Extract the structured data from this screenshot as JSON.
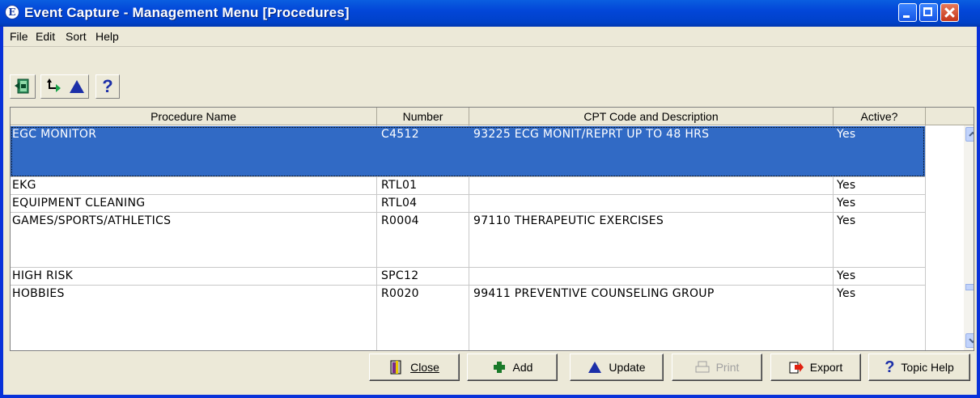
{
  "window": {
    "title": "Event Capture - Management Menu [Procedures]",
    "app_icon_glyph": "E"
  },
  "menu": [
    "File",
    "Edit",
    "Sort",
    "Help"
  ],
  "toolbar": {
    "icons": [
      "exit-icon",
      "move-to-icon",
      "up-arrow-icon",
      "help-icon"
    ],
    "help_glyph": "?"
  },
  "grid": {
    "columns": [
      "Procedure Name",
      "Number",
      "CPT Code and Description",
      "Active?"
    ],
    "rows": [
      {
        "name": "EGC MONITOR",
        "number": "C4512",
        "cpt": "93225  ECG MONIT/REPRT UP TO 48 HRS",
        "active": "Yes",
        "selected": true
      },
      {
        "name": "EKG",
        "number": "RTL01",
        "cpt": "",
        "active": "Yes"
      },
      {
        "name": "EQUIPMENT CLEANING",
        "number": "RTL04",
        "cpt": "",
        "active": "Yes"
      },
      {
        "name": "GAMES/SPORTS/ATHLETICS",
        "number": "R0004",
        "cpt": "97110  THERAPEUTIC EXERCISES",
        "active": "Yes"
      },
      {
        "name": "HIGH RISK",
        "number": "SPC12",
        "cpt": "",
        "active": "Yes"
      },
      {
        "name": "HOBBIES",
        "number": "R0020",
        "cpt": "99411  PREVENTIVE COUNSELING GROUP",
        "active": "Yes"
      }
    ]
  },
  "buttons": {
    "close": "Close",
    "add": "Add",
    "update": "Update",
    "print": "Print",
    "export": "Export",
    "topic_help": "Topic Help"
  },
  "colors": {
    "selection": "#316ac5",
    "title_bar": "#0346d8",
    "face": "#ece9d8"
  }
}
